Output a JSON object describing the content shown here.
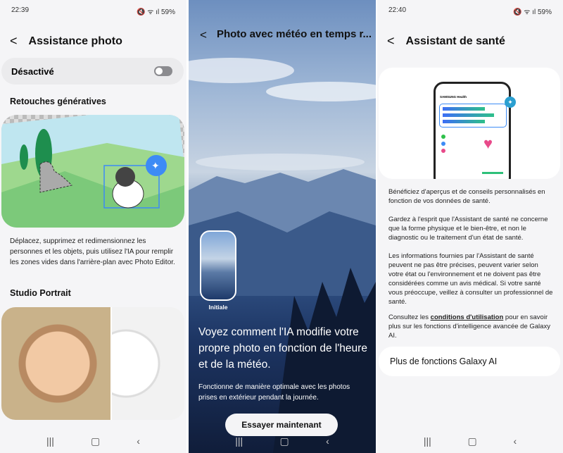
{
  "panels": [
    {
      "status": {
        "time": "22:39",
        "battery": "59%"
      },
      "title": "Assistance photo",
      "toggle": {
        "label": "Désactivé",
        "on": false
      },
      "section1": {
        "title": "Retouches génératives",
        "description": "Déplacez, supprimez et redimensionnez les personnes et les objets, puis utilisez l'IA pour remplir les zones vides dans l'arrière-plan avec Photo Editor."
      },
      "section2": {
        "title": "Studio Portrait"
      }
    },
    {
      "title": "Photo avec météo en temps r...",
      "thumbnail_label": "Initiale",
      "headline": "Voyez comment l'IA modifie votre propre photo en fonction de l'heure et de la météo.",
      "note": "Fonctionne de manière optimale avec les photos prises en extérieur pendant la journée.",
      "button": "Essayer maintenant"
    },
    {
      "status": {
        "time": "22:40",
        "battery": "59%"
      },
      "title": "Assistant de santé",
      "illustration": {
        "app_name": "SAMSUNG Health"
      },
      "paragraphs": [
        "Bénéficiez d'aperçus et de conseils personnalisés en fonction de vos données de santé.",
        "Gardez à l'esprit que l'Assistant de santé ne concerne que la forme physique et le bien-être, et non le diagnostic ou le traitement d'un état de santé.",
        "Les informations fournies par l'Assistant de santé peuvent ne pas être précises, peuvent varier selon votre état ou l'environnement et ne doivent pas être considérées comme un avis médical. Si votre santé vous préoccupe, veillez à consulter un professionnel de santé."
      ],
      "terms": {
        "prefix": "Consultez les ",
        "link": "conditions d'utilisation",
        "suffix": " pour en savoir plus sur les fonctions d'intelligence avancée de Galaxy AI."
      },
      "more": "Plus de fonctions Galaxy AI"
    }
  ],
  "nav_icons": {
    "recents": "|||",
    "home": "▢",
    "back": "‹"
  },
  "colors": {
    "accent": "#3d8bf5",
    "toggle_off": "#8b8b8f"
  }
}
